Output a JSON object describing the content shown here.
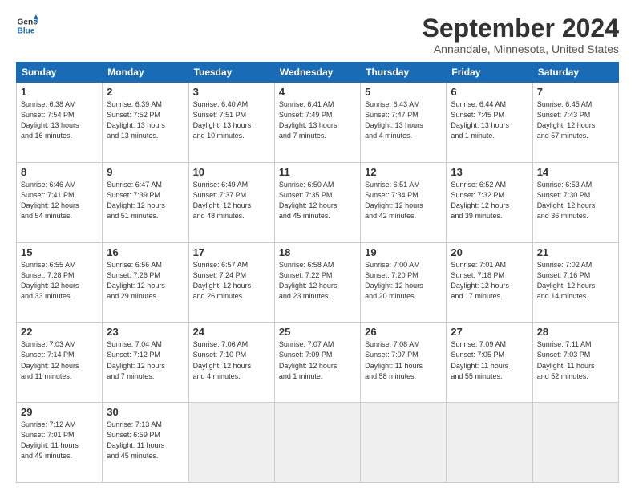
{
  "logo": {
    "line1": "General",
    "line2": "Blue"
  },
  "title": "September 2024",
  "subtitle": "Annandale, Minnesota, United States",
  "weekdays": [
    "Sunday",
    "Monday",
    "Tuesday",
    "Wednesday",
    "Thursday",
    "Friday",
    "Saturday"
  ],
  "weeks": [
    [
      {
        "day": "1",
        "sunrise": "6:38 AM",
        "sunset": "7:54 PM",
        "daylight": "13 hours and 16 minutes."
      },
      {
        "day": "2",
        "sunrise": "6:39 AM",
        "sunset": "7:52 PM",
        "daylight": "13 hours and 13 minutes."
      },
      {
        "day": "3",
        "sunrise": "6:40 AM",
        "sunset": "7:51 PM",
        "daylight": "13 hours and 10 minutes."
      },
      {
        "day": "4",
        "sunrise": "6:41 AM",
        "sunset": "7:49 PM",
        "daylight": "13 hours and 7 minutes."
      },
      {
        "day": "5",
        "sunrise": "6:43 AM",
        "sunset": "7:47 PM",
        "daylight": "13 hours and 4 minutes."
      },
      {
        "day": "6",
        "sunrise": "6:44 AM",
        "sunset": "7:45 PM",
        "daylight": "13 hours and 1 minute."
      },
      {
        "day": "7",
        "sunrise": "6:45 AM",
        "sunset": "7:43 PM",
        "daylight": "12 hours and 57 minutes."
      }
    ],
    [
      {
        "day": "8",
        "sunrise": "6:46 AM",
        "sunset": "7:41 PM",
        "daylight": "12 hours and 54 minutes."
      },
      {
        "day": "9",
        "sunrise": "6:47 AM",
        "sunset": "7:39 PM",
        "daylight": "12 hours and 51 minutes."
      },
      {
        "day": "10",
        "sunrise": "6:49 AM",
        "sunset": "7:37 PM",
        "daylight": "12 hours and 48 minutes."
      },
      {
        "day": "11",
        "sunrise": "6:50 AM",
        "sunset": "7:35 PM",
        "daylight": "12 hours and 45 minutes."
      },
      {
        "day": "12",
        "sunrise": "6:51 AM",
        "sunset": "7:34 PM",
        "daylight": "12 hours and 42 minutes."
      },
      {
        "day": "13",
        "sunrise": "6:52 AM",
        "sunset": "7:32 PM",
        "daylight": "12 hours and 39 minutes."
      },
      {
        "day": "14",
        "sunrise": "6:53 AM",
        "sunset": "7:30 PM",
        "daylight": "12 hours and 36 minutes."
      }
    ],
    [
      {
        "day": "15",
        "sunrise": "6:55 AM",
        "sunset": "7:28 PM",
        "daylight": "12 hours and 33 minutes."
      },
      {
        "day": "16",
        "sunrise": "6:56 AM",
        "sunset": "7:26 PM",
        "daylight": "12 hours and 29 minutes."
      },
      {
        "day": "17",
        "sunrise": "6:57 AM",
        "sunset": "7:24 PM",
        "daylight": "12 hours and 26 minutes."
      },
      {
        "day": "18",
        "sunrise": "6:58 AM",
        "sunset": "7:22 PM",
        "daylight": "12 hours and 23 minutes."
      },
      {
        "day": "19",
        "sunrise": "7:00 AM",
        "sunset": "7:20 PM",
        "daylight": "12 hours and 20 minutes."
      },
      {
        "day": "20",
        "sunrise": "7:01 AM",
        "sunset": "7:18 PM",
        "daylight": "12 hours and 17 minutes."
      },
      {
        "day": "21",
        "sunrise": "7:02 AM",
        "sunset": "7:16 PM",
        "daylight": "12 hours and 14 minutes."
      }
    ],
    [
      {
        "day": "22",
        "sunrise": "7:03 AM",
        "sunset": "7:14 PM",
        "daylight": "12 hours and 11 minutes."
      },
      {
        "day": "23",
        "sunrise": "7:04 AM",
        "sunset": "7:12 PM",
        "daylight": "12 hours and 7 minutes."
      },
      {
        "day": "24",
        "sunrise": "7:06 AM",
        "sunset": "7:10 PM",
        "daylight": "12 hours and 4 minutes."
      },
      {
        "day": "25",
        "sunrise": "7:07 AM",
        "sunset": "7:09 PM",
        "daylight": "12 hours and 1 minute."
      },
      {
        "day": "26",
        "sunrise": "7:08 AM",
        "sunset": "7:07 PM",
        "daylight": "11 hours and 58 minutes."
      },
      {
        "day": "27",
        "sunrise": "7:09 AM",
        "sunset": "7:05 PM",
        "daylight": "11 hours and 55 minutes."
      },
      {
        "day": "28",
        "sunrise": "7:11 AM",
        "sunset": "7:03 PM",
        "daylight": "11 hours and 52 minutes."
      }
    ],
    [
      {
        "day": "29",
        "sunrise": "7:12 AM",
        "sunset": "7:01 PM",
        "daylight": "11 hours and 49 minutes."
      },
      {
        "day": "30",
        "sunrise": "7:13 AM",
        "sunset": "6:59 PM",
        "daylight": "11 hours and 45 minutes."
      },
      null,
      null,
      null,
      null,
      null
    ]
  ]
}
